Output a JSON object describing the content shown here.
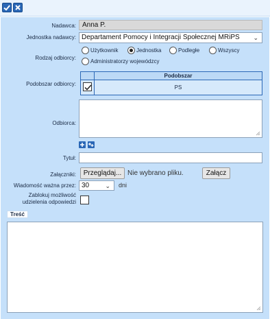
{
  "toolbar": {
    "confirm_icon": "checkmark-icon",
    "close_icon": "close-icon"
  },
  "form": {
    "nadawca_label": "Nadawca:",
    "nadawca_value": "Anna P.",
    "jednostka_label": "Jednostka nadawcy:",
    "jednostka_value": "Departament Pomocy i Integracji Społecznej MRiPS",
    "rodzaj_label": "Rodzaj odbiorcy:",
    "rodzaj_options": [
      "Użytkownik",
      "Jednostka",
      "Podległe",
      "Wszyscy",
      "Administratorzy wojewódzcy"
    ],
    "rodzaj_selected": "Jednostka",
    "podobszar_label": "Podobszar odbiorcy:",
    "podobszar_header": "Podobszar",
    "podobszar_row_value": "PS",
    "podobszar_row_checked": true,
    "odbiorca_label": "Odbiorca:",
    "odbiorca_add_icon": "plus-icon",
    "odbiorca_add_group_icon": "add-group-icon",
    "tytul_label": "Tytuł:",
    "tytul_value": "",
    "zalaczniki_label": "Załączniki:",
    "browse_button": "Przeglądaj...",
    "no_file_text": "Nie wybrano pliku.",
    "attach_button": "Załącz",
    "valid_label": "Wiadomość ważna przez:",
    "valid_value": "30",
    "valid_unit": "dni",
    "block_label": "Zablokuj możliwość udzielenia odpowiedzi",
    "block_checked": false,
    "tresc_label": "Treść"
  },
  "colors": {
    "form_bg": "#c5e0fa",
    "accent": "#2a67b6"
  }
}
